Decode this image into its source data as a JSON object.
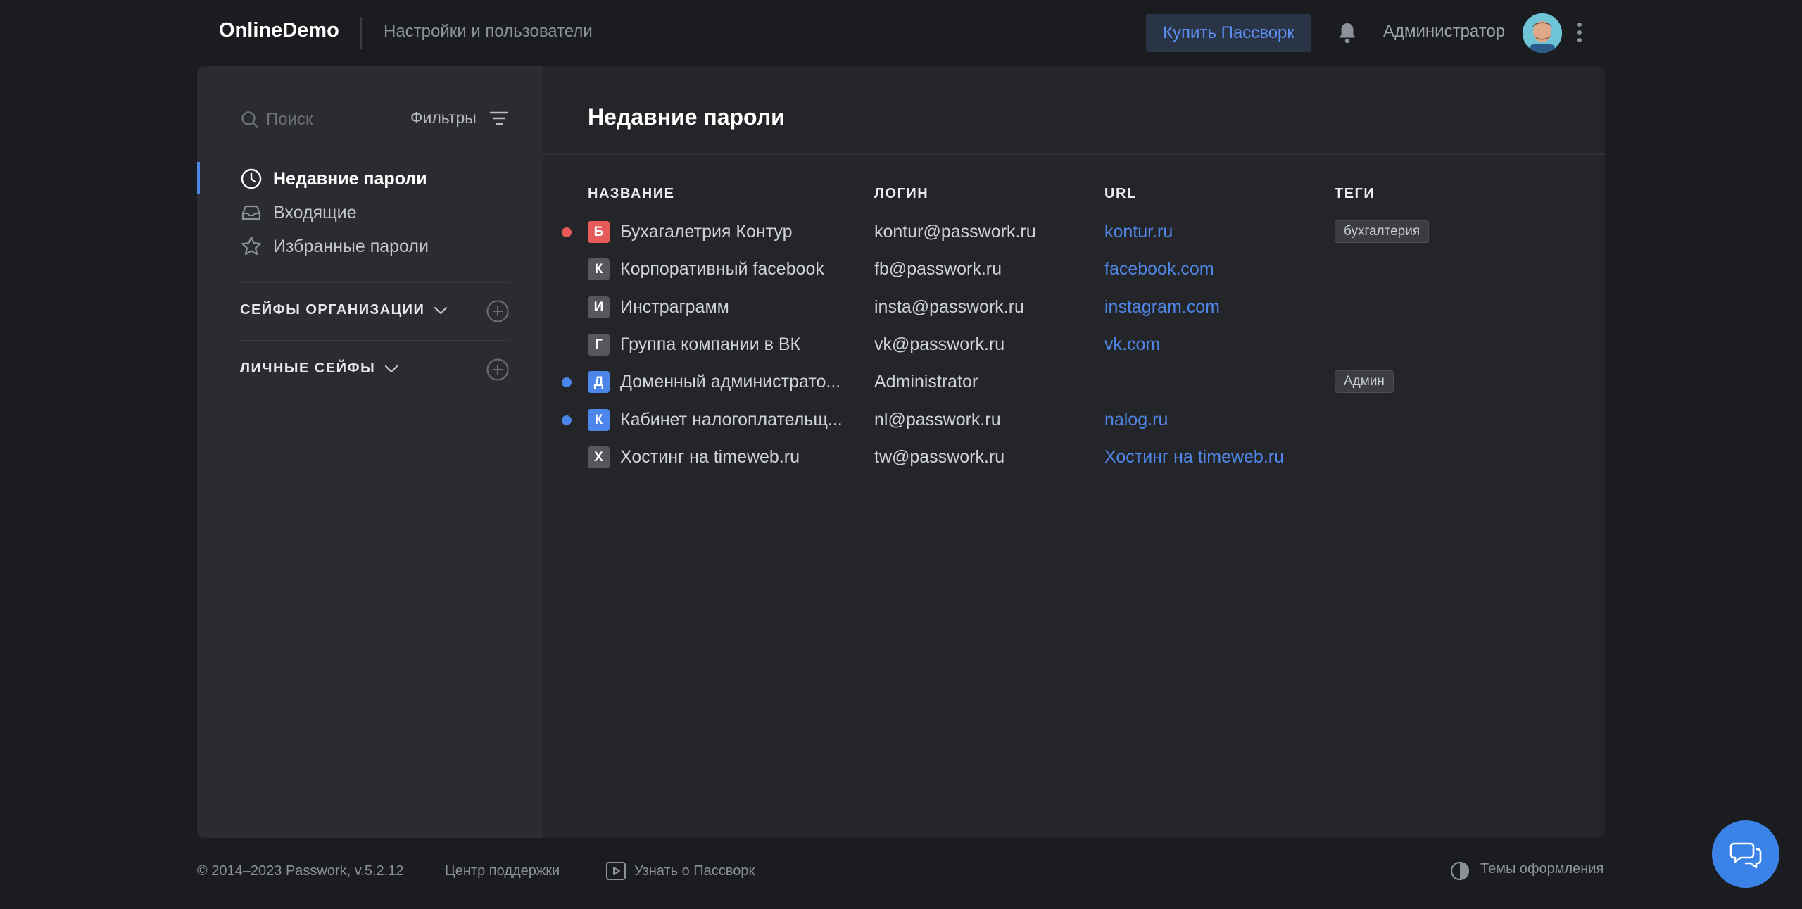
{
  "header": {
    "brand": "OnlineDemo",
    "settings_link": "Настройки и пользователи",
    "buy_button": "Купить Пассворк",
    "user_name": "Администратор"
  },
  "sidebar": {
    "search_placeholder": "Поиск",
    "filters_label": "Фильтры",
    "nav": [
      {
        "label": "Недавние пароли",
        "icon": "clock-icon",
        "active": true
      },
      {
        "label": "Входящие",
        "icon": "inbox-icon",
        "active": false
      },
      {
        "label": "Избранные пароли",
        "icon": "star-icon",
        "active": false
      }
    ],
    "sections": [
      {
        "label": "СЕЙФЫ ОРГАНИЗАЦИИ"
      },
      {
        "label": "ЛИЧНЫЕ СЕЙФЫ"
      }
    ]
  },
  "main": {
    "title": "Недавние пароли",
    "columns": {
      "name": "НАЗВАНИЕ",
      "login": "ЛОГИН",
      "url": "URL",
      "tags": "ТЕГИ"
    },
    "rows": [
      {
        "status_color": "#e85a5a",
        "badge": "Б",
        "badge_color": "#e85a5a",
        "name": "Бухагалетрия Контур",
        "login": "kontur@passwork.ru",
        "url": "kontur.ru",
        "tag": "бухгалтерия"
      },
      {
        "status_color": "",
        "badge": "К",
        "badge_color": "#55575d",
        "name": "Корпоративный facebook",
        "login": "fb@passwork.ru",
        "url": "facebook.com",
        "tag": ""
      },
      {
        "status_color": "",
        "badge": "И",
        "badge_color": "#55575d",
        "name": "Инстраграмм",
        "login": "insta@passwork.ru",
        "url": "instagram.com",
        "tag": ""
      },
      {
        "status_color": "",
        "badge": "Г",
        "badge_color": "#55575d",
        "name": "Группа компании в ВК",
        "login": "vk@passwork.ru",
        "url": "vk.com",
        "tag": ""
      },
      {
        "status_color": "#4d86ea",
        "badge": "Д",
        "badge_color": "#4d86ea",
        "name": "Доменный администрато...",
        "login": "Administrator",
        "url": "",
        "tag": "Админ"
      },
      {
        "status_color": "#4d86ea",
        "badge": "К",
        "badge_color": "#4d86ea",
        "name": "Кабинет налогоплательщ...",
        "login": "nl@passwork.ru",
        "url": "nalog.ru",
        "tag": ""
      },
      {
        "status_color": "",
        "badge": "Х",
        "badge_color": "#55575d",
        "name": "Хостинг на timeweb.ru",
        "login": "tw@passwork.ru",
        "url": "Хостинг на timeweb.ru",
        "tag": ""
      }
    ]
  },
  "footer": {
    "copyright": "© 2014–2023 Passwork, v.5.2.12",
    "support": "Центр поддержки",
    "learn": "Узнать о Пассворк",
    "themes": "Темы оформления"
  }
}
